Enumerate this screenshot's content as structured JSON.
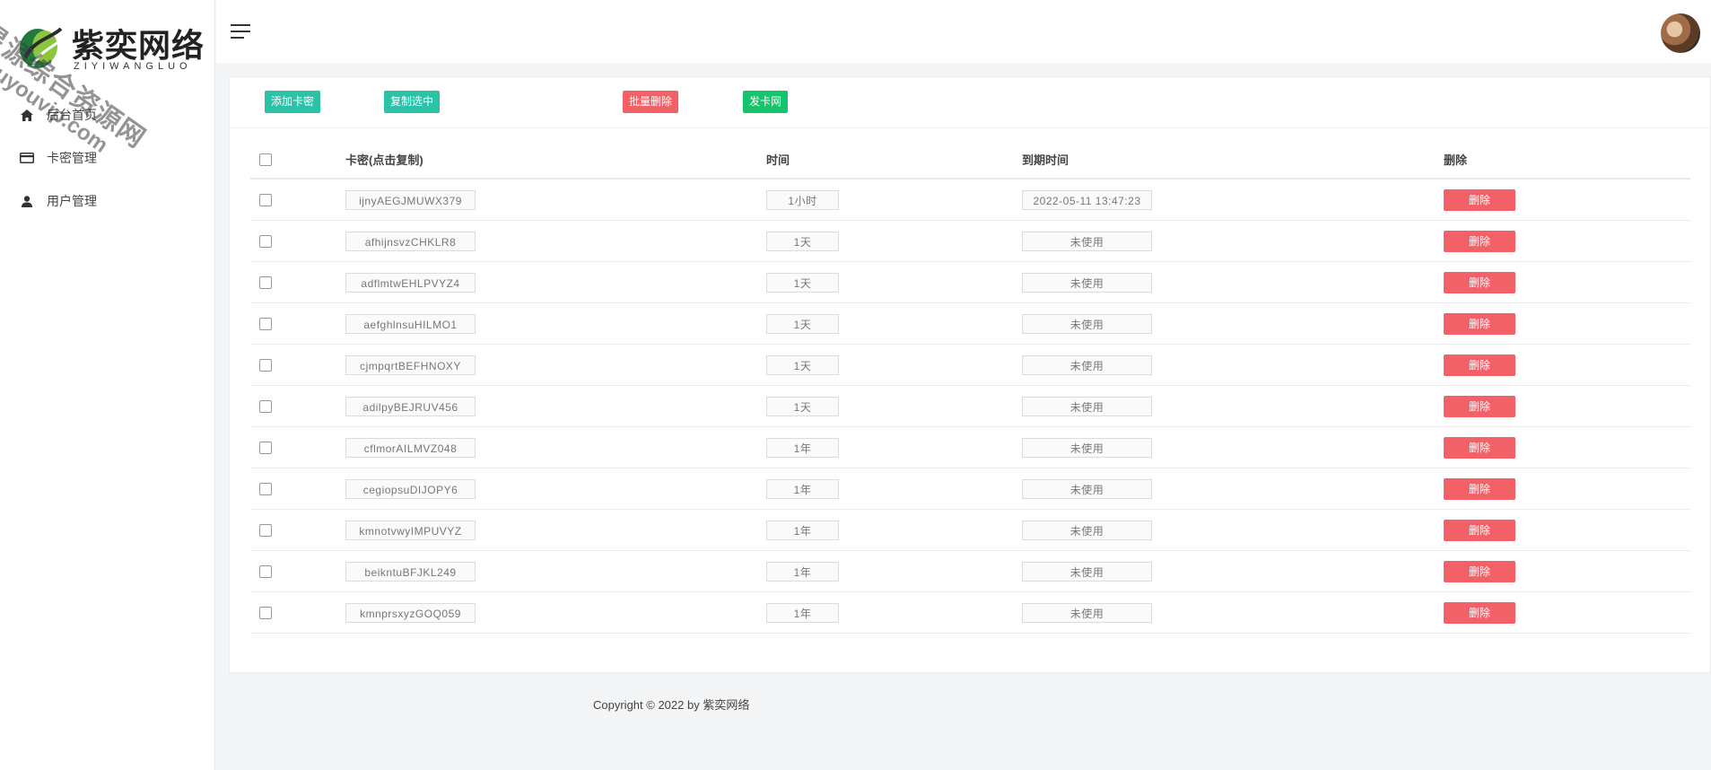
{
  "brand": {
    "title": "紫奕网络",
    "subtitle": "ZIYIWANGLUO"
  },
  "watermark": {
    "line1": "星源综合资源网",
    "line2": "douyouvip.com"
  },
  "sidebar": {
    "items": [
      {
        "label": "后台首页",
        "icon": "home-icon"
      },
      {
        "label": "卡密管理",
        "icon": "card-icon"
      },
      {
        "label": "用户管理",
        "icon": "user-icon"
      }
    ]
  },
  "toolbar": {
    "add_label": "添加卡密",
    "copy_label": "复制选中",
    "batch_delete_label": "批量删除",
    "send_label": "发卡网"
  },
  "table": {
    "headers": {
      "key": "卡密(点击复制)",
      "time": "时间",
      "expire": "到期时间",
      "delete": "删除"
    },
    "delete_label": "删除",
    "rows": [
      {
        "key": "ijnyAEGJMUWX379",
        "time": "1小时",
        "expire": "2022-05-11 13:47:23"
      },
      {
        "key": "afhijnsvzCHKLR8",
        "time": "1天",
        "expire": "未使用"
      },
      {
        "key": "adflmtwEHLPVYZ4",
        "time": "1天",
        "expire": "未使用"
      },
      {
        "key": "aefghlnsuHILMO1",
        "time": "1天",
        "expire": "未使用"
      },
      {
        "key": "cjmpqrtBEFHNOXY",
        "time": "1天",
        "expire": "未使用"
      },
      {
        "key": "adilpyBEJRUV456",
        "time": "1天",
        "expire": "未使用"
      },
      {
        "key": "cflmorAILMVZ048",
        "time": "1年",
        "expire": "未使用"
      },
      {
        "key": "cegiopsuDIJOPY6",
        "time": "1年",
        "expire": "未使用"
      },
      {
        "key": "kmnotvwyIMPUVYZ",
        "time": "1年",
        "expire": "未使用"
      },
      {
        "key": "beikntuBFJKL249",
        "time": "1年",
        "expire": "未使用"
      },
      {
        "key": "kmnprsxyzGOQ059",
        "time": "1年",
        "expire": "未使用"
      }
    ]
  },
  "footer": {
    "copyright": "Copyright © 2022 by 紫奕网络"
  },
  "colors": {
    "teal": "#2bc2a8",
    "red": "#f26068",
    "green": "#16c56b"
  }
}
